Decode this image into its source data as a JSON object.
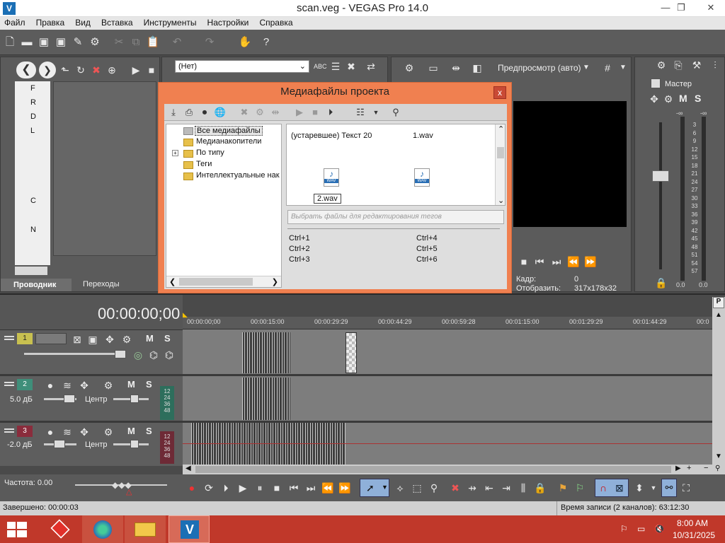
{
  "window": {
    "title": "scan.veg - VEGAS Pro 14.0",
    "minimize": "—",
    "maximize": "❐",
    "close": "✕"
  },
  "menu": [
    "Файл",
    "Правка",
    "Вид",
    "Вставка",
    "Инструменты",
    "Настройки",
    "Справка"
  ],
  "explorer": {
    "tabs": [
      "Проводник",
      "Переходы"
    ],
    "tree_labels": [
      "F",
      "R",
      "D",
      "L",
      "C",
      "N"
    ]
  },
  "trimmer": {
    "dropdown_value": "(Нет)"
  },
  "preview": {
    "mode_label": "Предпросмотр (авто)",
    "frame_label": "Кадр:",
    "frame_value": "0",
    "display_label": "Отобразить:",
    "display_value": "317x178x32"
  },
  "master": {
    "label": "Мастер",
    "m": "M",
    "s": "S",
    "left_top": "-∞",
    "right_top": "-∞",
    "scale": [
      "3",
      "6",
      "9",
      "12",
      "15",
      "18",
      "21",
      "24",
      "27",
      "30",
      "33",
      "36",
      "39",
      "42",
      "45",
      "48",
      "51",
      "54",
      "57"
    ],
    "bottom_left": "0.0",
    "bottom_right": "0.0"
  },
  "dialog": {
    "title": "Медиафайлы проекта",
    "close": "x",
    "tree": [
      "Все медиафайлы",
      "Медианакопители",
      "По типу",
      "Теги",
      "Интеллектуальные нак"
    ],
    "files": [
      {
        "name": "(устаревшее) Текст 20"
      },
      {
        "name": "1.wav"
      },
      {
        "name": "2.wav",
        "badge": "WAV"
      },
      {
        "name": "",
        "badge": "WAV"
      }
    ],
    "tags_placeholder": "Выбрать файлы для редактирования тегов",
    "shortcuts_left": [
      "Ctrl+1",
      "Ctrl+2",
      "Ctrl+3"
    ],
    "shortcuts_right": [
      "Ctrl+4",
      "Ctrl+5",
      "Ctrl+6"
    ]
  },
  "timeline": {
    "timecode": "00:00:00;00",
    "ruler": [
      "00:00:00;00",
      "00:00:15:00",
      "00:00:29:29",
      "00:00:44:29",
      "00:00:59:28",
      "00:01:15:00",
      "00:01:29:29",
      "00:01:44:29",
      "00:0"
    ],
    "tracks": [
      {
        "num": "1",
        "color": "#c8c050",
        "type": "video"
      },
      {
        "num": "2",
        "color": "#3f8f7a",
        "type": "audio",
        "volume": "5.0 дБ",
        "pan": "Центр",
        "meter": [
          "12",
          "24",
          "36",
          "48"
        ]
      },
      {
        "num": "3",
        "color": "#8a2c3c",
        "type": "audio",
        "volume": "-2.0 дБ",
        "pan": "Центр",
        "meter": [
          "12",
          "24",
          "36",
          "48"
        ]
      }
    ],
    "m": "M",
    "s": "S"
  },
  "transport": {
    "rate_label": "Частота: 0.00"
  },
  "status": {
    "left": "Завершено: 00:00:03",
    "right": "Время записи (2 каналов): 63:12:30"
  },
  "taskbar": {
    "time": "8:00 AM",
    "date": "10/31/2025"
  }
}
